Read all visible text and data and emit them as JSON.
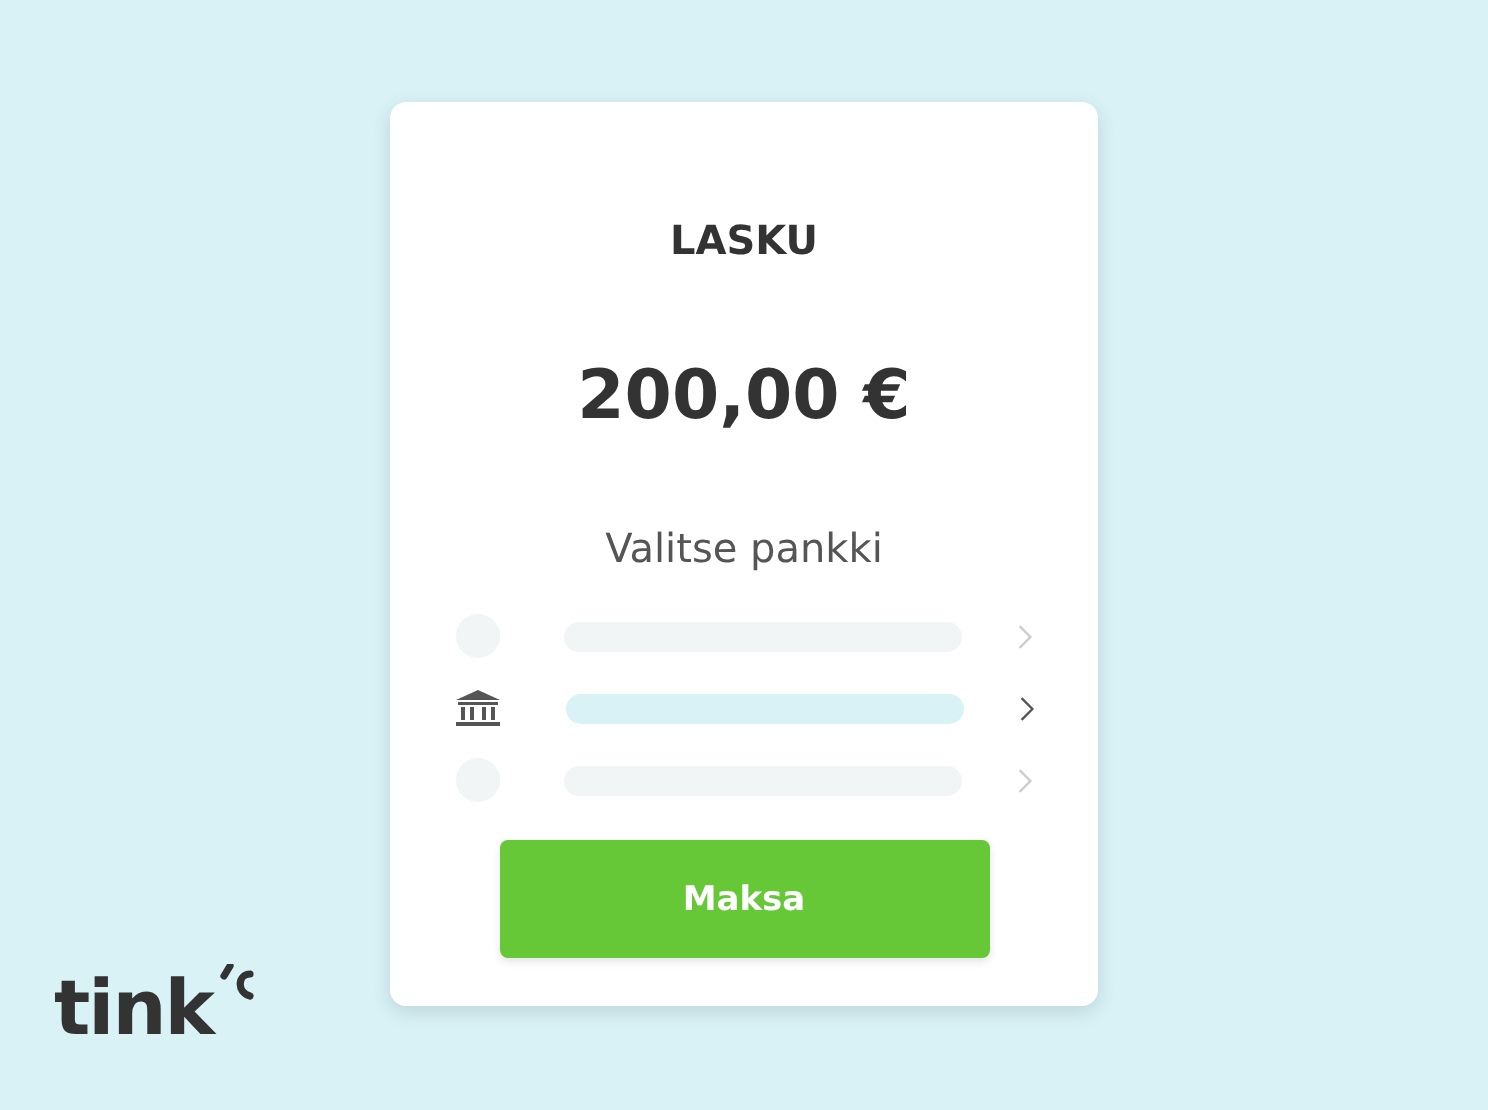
{
  "card": {
    "title": "LASKU",
    "amount": "200,00 €",
    "prompt": "Valitse pankki",
    "banks": [
      {
        "selected": false
      },
      {
        "selected": true
      },
      {
        "selected": false
      }
    ],
    "button": "Maksa"
  },
  "logo": {
    "text": "tink"
  }
}
